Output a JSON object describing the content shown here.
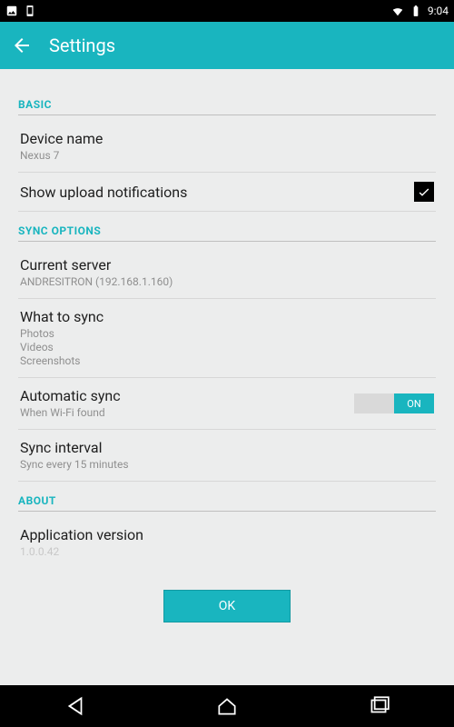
{
  "status": {
    "time": "9:04"
  },
  "appbar": {
    "title": "Settings"
  },
  "sections": {
    "basic": {
      "header": "BASIC",
      "device_name": {
        "title": "Device name",
        "value": "Nexus 7"
      },
      "upload_notif": {
        "title": "Show upload notifications"
      }
    },
    "sync": {
      "header": "SYNC OPTIONS",
      "server": {
        "title": "Current server",
        "value": "ANDRESITRON (192.168.1.160)"
      },
      "what": {
        "title": "What to sync",
        "value": "Photos\nVideos\nScreenshots"
      },
      "auto": {
        "title": "Automatic sync",
        "value": "When Wi-Fi found",
        "toggle_label": "ON"
      },
      "interval": {
        "title": "Sync interval",
        "value": "Sync every 15 minutes"
      }
    },
    "about": {
      "header": "ABOUT",
      "version": {
        "title": "Application version",
        "value": "1.0.0.42"
      }
    }
  },
  "ok_label": "OK"
}
